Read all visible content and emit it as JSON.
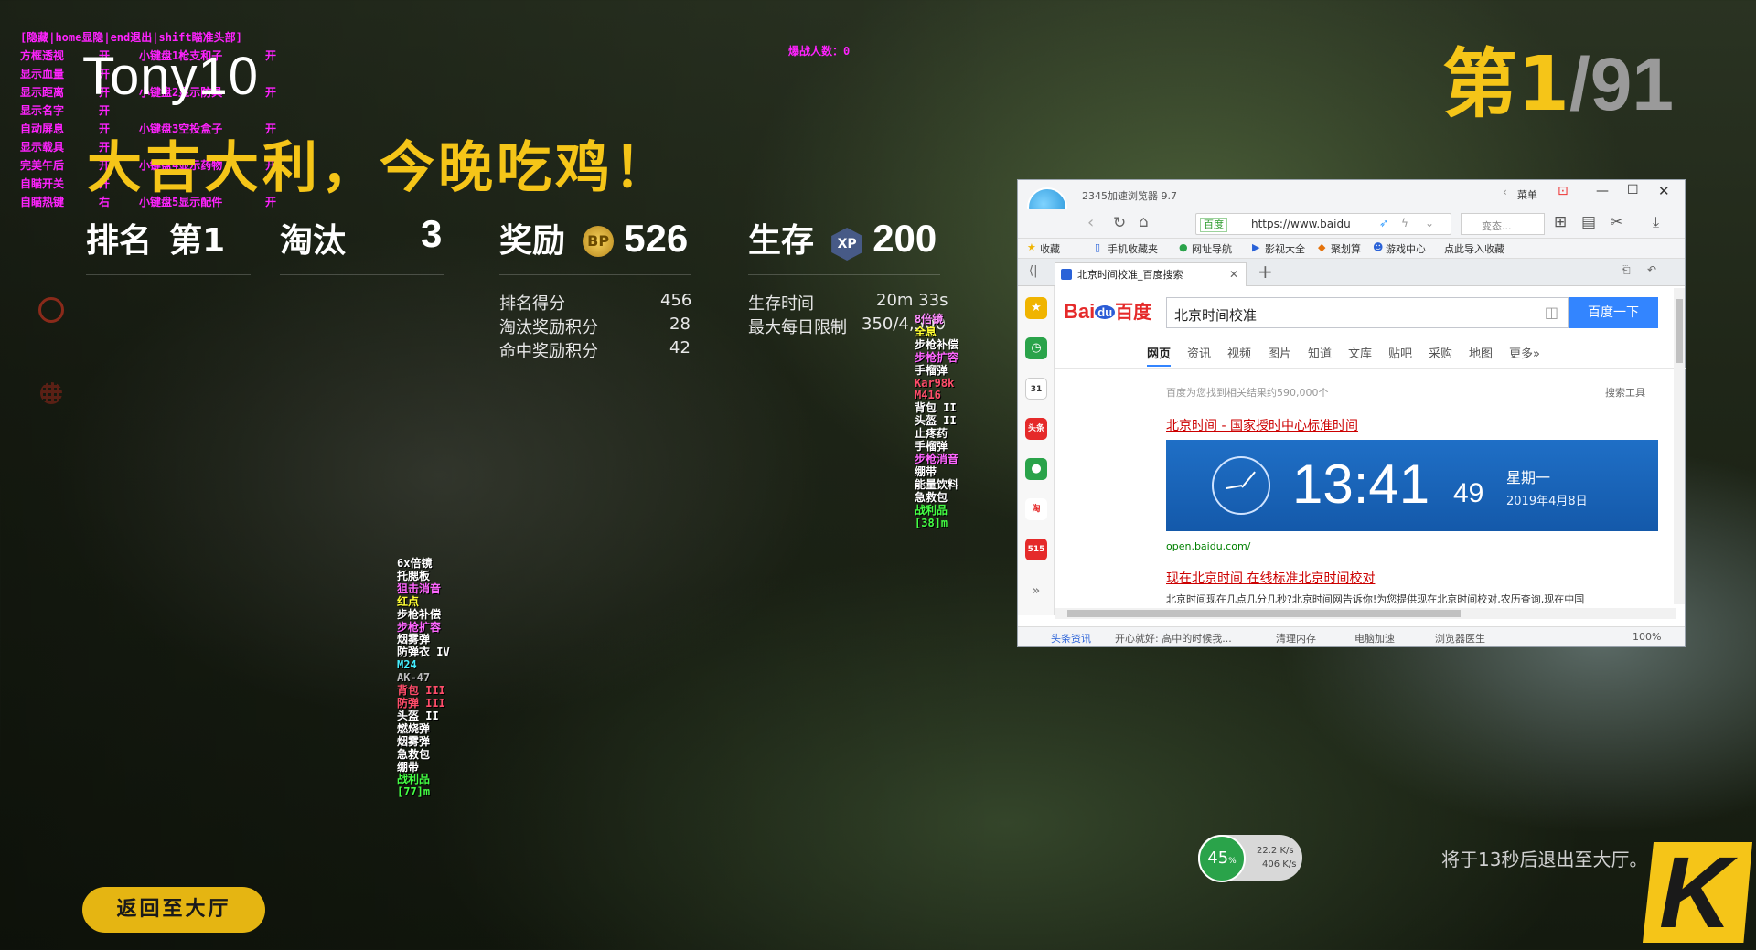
{
  "cheat_menu": {
    "header": "[隐藏|home显隐|end退出|shift瞄准头部]",
    "rows": [
      {
        "name": "方框透视",
        "state": "开",
        "extra": "小键盘1枪支和子",
        "extra_state": "开"
      },
      {
        "name": "显示血量",
        "state": "开",
        "extra": "",
        "extra_state": ""
      },
      {
        "name": "显示距离",
        "state": "开",
        "extra": "小键盘2显示防具",
        "extra_state": "开"
      },
      {
        "name": "显示名字",
        "state": "开",
        "extra": "",
        "extra_state": ""
      },
      {
        "name": "自动屏息",
        "state": "开",
        "extra": "小键盘3空投盒子",
        "extra_state": "开"
      },
      {
        "name": "显示载具",
        "state": "开",
        "extra": "",
        "extra_state": ""
      },
      {
        "name": "完美午后",
        "state": "开",
        "extra": "小键盘4显示药物",
        "extra_state": "开"
      },
      {
        "name": "自瞄开关",
        "state": "开",
        "extra": "",
        "extra_state": ""
      },
      {
        "name": "自瞄热键",
        "state": "右",
        "extra": "小键盘5显示配件",
        "extra_state": "开"
      }
    ],
    "kill_counter": "爆战人数：0"
  },
  "results": {
    "player_name": "Tony10",
    "win_text": "大吉大利，今晚吃鸡！",
    "rank_label": "排名",
    "rank_value": "第1",
    "kills_label": "淘汰",
    "kills_value": "3",
    "reward_label": "奖励",
    "reward_icon": "BP",
    "reward_value": "526",
    "survive_label": "生存",
    "xp_icon": "XP",
    "xp_value": "200",
    "rank_score_label": "排名得分",
    "rank_score_value": "456",
    "kill_bonus_label": "淘汰奖励积分",
    "kill_bonus_value": "28",
    "hit_bonus_label": "命中奖励积分",
    "hit_bonus_value": "42",
    "survive_time_label": "生存时间",
    "survive_time_value": "20m 33s",
    "daily_limit_label": "最大每日限制",
    "daily_limit_value": "350/4,500",
    "rank_big": "第1",
    "rank_total": "/91",
    "back_button": "返回至大厅",
    "exit_countdown": "将于13秒后退出至大厅。"
  },
  "loot_right": [
    {
      "t": "8倍镜",
      "c": "#ff8cff"
    },
    {
      "t": "全息",
      "c": "#ffff33"
    },
    {
      "t": "步枪补偿",
      "c": "#ffffff"
    },
    {
      "t": "步枪扩容",
      "c": "#ff66ff"
    },
    {
      "t": "手榴弹",
      "c": "#ffffff"
    },
    {
      "t": "Kar98k",
      "c": "#ff4d6a"
    },
    {
      "t": "M416",
      "c": "#ff4d6a"
    },
    {
      "t": "背包 II",
      "c": "#ffffff"
    },
    {
      "t": "头盔 II",
      "c": "#ffffff"
    },
    {
      "t": "止疼药",
      "c": "#ffffff"
    },
    {
      "t": "手榴弹",
      "c": "#ffffff"
    },
    {
      "t": "步枪消音",
      "c": "#ff66ff"
    },
    {
      "t": "绷带",
      "c": "#ffffff"
    },
    {
      "t": "能量饮料",
      "c": "#ffffff"
    },
    {
      "t": "急救包",
      "c": "#ffffff"
    },
    {
      "t": "战利品",
      "c": "#44ff44"
    },
    {
      "t": "[38]m",
      "c": "#44ff44"
    }
  ],
  "loot_left": [
    {
      "t": "6x倍镜",
      "c": "#ffffff"
    },
    {
      "t": "托腮板",
      "c": "#ffffff"
    },
    {
      "t": "狙击消音",
      "c": "#ff66ff"
    },
    {
      "t": "红点",
      "c": "#ffff33"
    },
    {
      "t": "步枪补偿",
      "c": "#ffffff"
    },
    {
      "t": "步枪扩容",
      "c": "#ff66ff"
    },
    {
      "t": "烟雾弹",
      "c": "#ffffff"
    },
    {
      "t": "防弹衣 IV",
      "c": "#ffffff"
    },
    {
      "t": "M24",
      "c": "#44eeff"
    },
    {
      "t": "AK-47",
      "c": "#bbbbbb"
    },
    {
      "t": "背包 III",
      "c": "#ff4d6a"
    },
    {
      "t": "防弹 III",
      "c": "#ff4d6a"
    },
    {
      "t": "头盔 II",
      "c": "#ffffff"
    },
    {
      "t": "燃烧弹",
      "c": "#ffffff"
    },
    {
      "t": "烟雾弹",
      "c": "#ffffff"
    },
    {
      "t": "急救包",
      "c": "#ffffff"
    },
    {
      "t": "绷带",
      "c": "#ffffff"
    },
    {
      "t": "战利品",
      "c": "#44ff44"
    },
    {
      "t": "[77]m",
      "c": "#44ff44"
    }
  ],
  "browser": {
    "title": "2345加速浏览器 9.7",
    "menu": "菜单",
    "secure_badge": "百度",
    "url": "https://www.baidu",
    "search_placeholder": "变态...",
    "favorites": [
      "收藏",
      "手机收藏夹",
      "网址导航",
      "影视大全",
      "聚划算",
      "游戏中心",
      "点此导入收藏"
    ],
    "tab_title": "北京时间校准_百度搜索",
    "baidu_logo_bai": "Bai",
    "baidu_logo_du": "du",
    "baidu_logo_cn": "百度",
    "query": "北京时间校准",
    "search_button": "百度一下",
    "nav_tabs": [
      "网页",
      "资讯",
      "视频",
      "图片",
      "知道",
      "文库",
      "贴吧",
      "采购",
      "地图",
      "更多»"
    ],
    "result_count": "百度为您找到相关结果约590,000个",
    "search_tools": "搜索工具",
    "result1_title": "北京时间 - 国家授时中心标准时间",
    "clock_time": "13:41",
    "clock_seconds": "49",
    "clock_weekday": "星期一",
    "clock_date": "2019年4月8日",
    "result1_url": "open.baidu.com/",
    "result2_title": "现在北京时间 在线标准北京时间校对",
    "result2_snippet": "北京时间现在几点几分几秒?北京时间网告诉你!为您提供现在北京时间校对,农历查询,现在中国",
    "sidebar_icons": [
      "收藏",
      "历史",
      "31",
      "头条",
      "微信",
      "淘",
      "515"
    ],
    "status": {
      "news": "头条资讯",
      "ticker": "开心就好: 高中的时候我...",
      "clean": "清理内存",
      "accel": "电脑加速",
      "doctor": "浏览器医生",
      "zoom": "100%"
    }
  },
  "net_widget": {
    "cpu_percent": "45",
    "percent_sign": "%",
    "up_speed": "22.2 K/s",
    "down_speed": "406 K/s"
  },
  "logo_letter": "K"
}
